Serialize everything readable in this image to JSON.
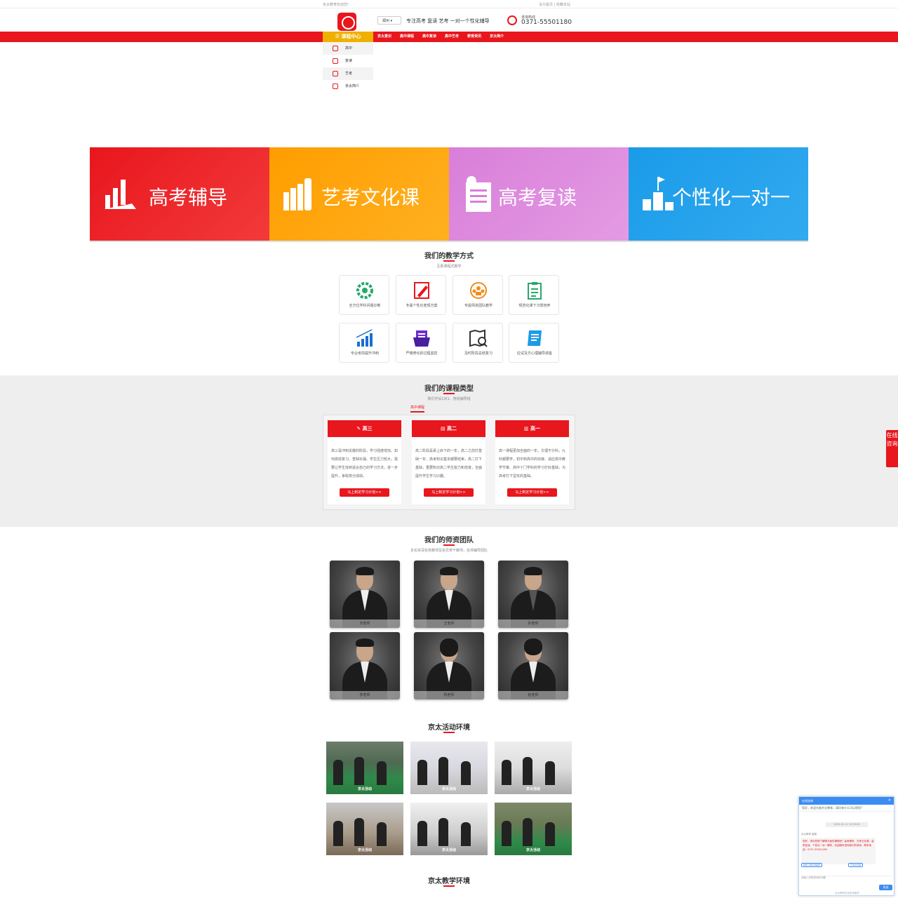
{
  "topbar": {
    "left_text": "京太教育欢迎您!",
    "right_text": "设为首页 | 收藏本站"
  },
  "header": {
    "city": "郑州",
    "slogan": "专注高考 复读 艺考 一对一个性化辅导",
    "phone_label": "咨询热线",
    "phone": "0371-55501180"
  },
  "nav": {
    "course_center": "☰ 课程中心",
    "items": [
      "京太意识",
      "高中课程",
      "高中复读",
      "高中艺考",
      "教育资讯",
      "京太简介"
    ]
  },
  "menu": {
    "items": [
      "高中",
      "复读",
      "艺考",
      "京太简介"
    ]
  },
  "banners": [
    {
      "title": "高考辅导",
      "color": "#e8161d",
      "icon": "bar-chart-icon"
    },
    {
      "title": "艺考文化课",
      "color": "#ff9d00",
      "icon": "books-icon"
    },
    {
      "title": "高考复读",
      "color": "#d97ed9",
      "icon": "checklist-icon"
    },
    {
      "title": "个性化一对一",
      "color": "#1a9be8",
      "icon": "podium-flag-icon"
    }
  ],
  "teaching": {
    "title": "我们的教学方式",
    "subtitle": "互助课程式教学",
    "methods": [
      {
        "label": "全方位学科问题诊断",
        "icon": "gear-icon",
        "color": "#27a86a"
      },
      {
        "label": "专属个性化老规方案",
        "icon": "pencil-icon",
        "color": "#e8161d"
      },
      {
        "label": "专属师资团队教学",
        "icon": "team-target-icon",
        "color": "#f08c1a"
      },
      {
        "label": "规范化课下习惯培养",
        "icon": "clipboard-icon",
        "color": "#27a86a"
      },
      {
        "label": "专业考前提升冲刺",
        "icon": "growth-chart-icon",
        "color": "#1a6fd1"
      },
      {
        "label": "严格修化的过程监控",
        "icon": "folder-icon",
        "color": "#6a2fd1"
      },
      {
        "label": "及时阶段总结复习",
        "icon": "map-search-icon",
        "color": "#333333"
      },
      {
        "label": "应试及方心理辅导讲座",
        "icon": "book-icon",
        "color": "#1a9be8"
      }
    ]
  },
  "courses": {
    "title": "我们的课程类型",
    "subtitle": "我们开设1对1、普班辅导班",
    "tab": "高中课程",
    "cards": [
      {
        "title": "高三",
        "desc": "高三是冲刺关键的阶段，学习强度增加，如何高效复习、查缺补漏、学生压力较大，需要让学生找到适合自己的学习方法，进一步提升，争取高分成绩。",
        "button": "马上制定学习计划>>"
      },
      {
        "title": "高二",
        "desc": "高二阶段是承上启下的一年，高二之前打基础一年、高考知识基本都要结束，高二打下基础，重要知识高二学生能力和态度，全面提升学生学习兴趣。",
        "button": "马上制定学习计划>>"
      },
      {
        "title": "高一",
        "desc": "高一课程更加全面的一年，文理不分科，九科都要学，初中到高中的衔接、适应高中教学节奏、高中十门学科的学习打好基础，为高考打下坚实的基础。",
        "button": "马上制定学习计划>>"
      }
    ]
  },
  "teachers": {
    "title": "我们的师资团队",
    "subtitle": "多名资深名校教师及名优骨干教师，名师辅导团队",
    "list": [
      "刘老师",
      "王老师",
      "孙老师",
      "李老师",
      "杨老师",
      "赵老师"
    ]
  },
  "activities": {
    "title": "京太活动环境",
    "captions": [
      "京太活动",
      "京太活动",
      "京太活动",
      "京太活动",
      "京太活动",
      "京太活动"
    ]
  },
  "teaching_env": {
    "title": "京太教学环境"
  },
  "side": {
    "consult": "在线咨询"
  },
  "chat": {
    "title": "在线咨询",
    "info": "您好，欢迎光临京太教育，请问有什么可以帮您？",
    "time": "2024-01-12 10:00:00",
    "from": "京太教育 客服",
    "message": "您好，请问您想了解哪方面的课程呢？高考辅导、艺考文化课、高考复读、个性化一对一辅导，欢迎随时咨询我们的老师，联系电话：0371-55501180",
    "quick_replies": [
      "我想了解高考辅导",
      "艺考文化课"
    ],
    "input_placeholder": "请输入您想咨询的问题",
    "send": "发送",
    "footer": "京太教育在线咨询服务"
  }
}
